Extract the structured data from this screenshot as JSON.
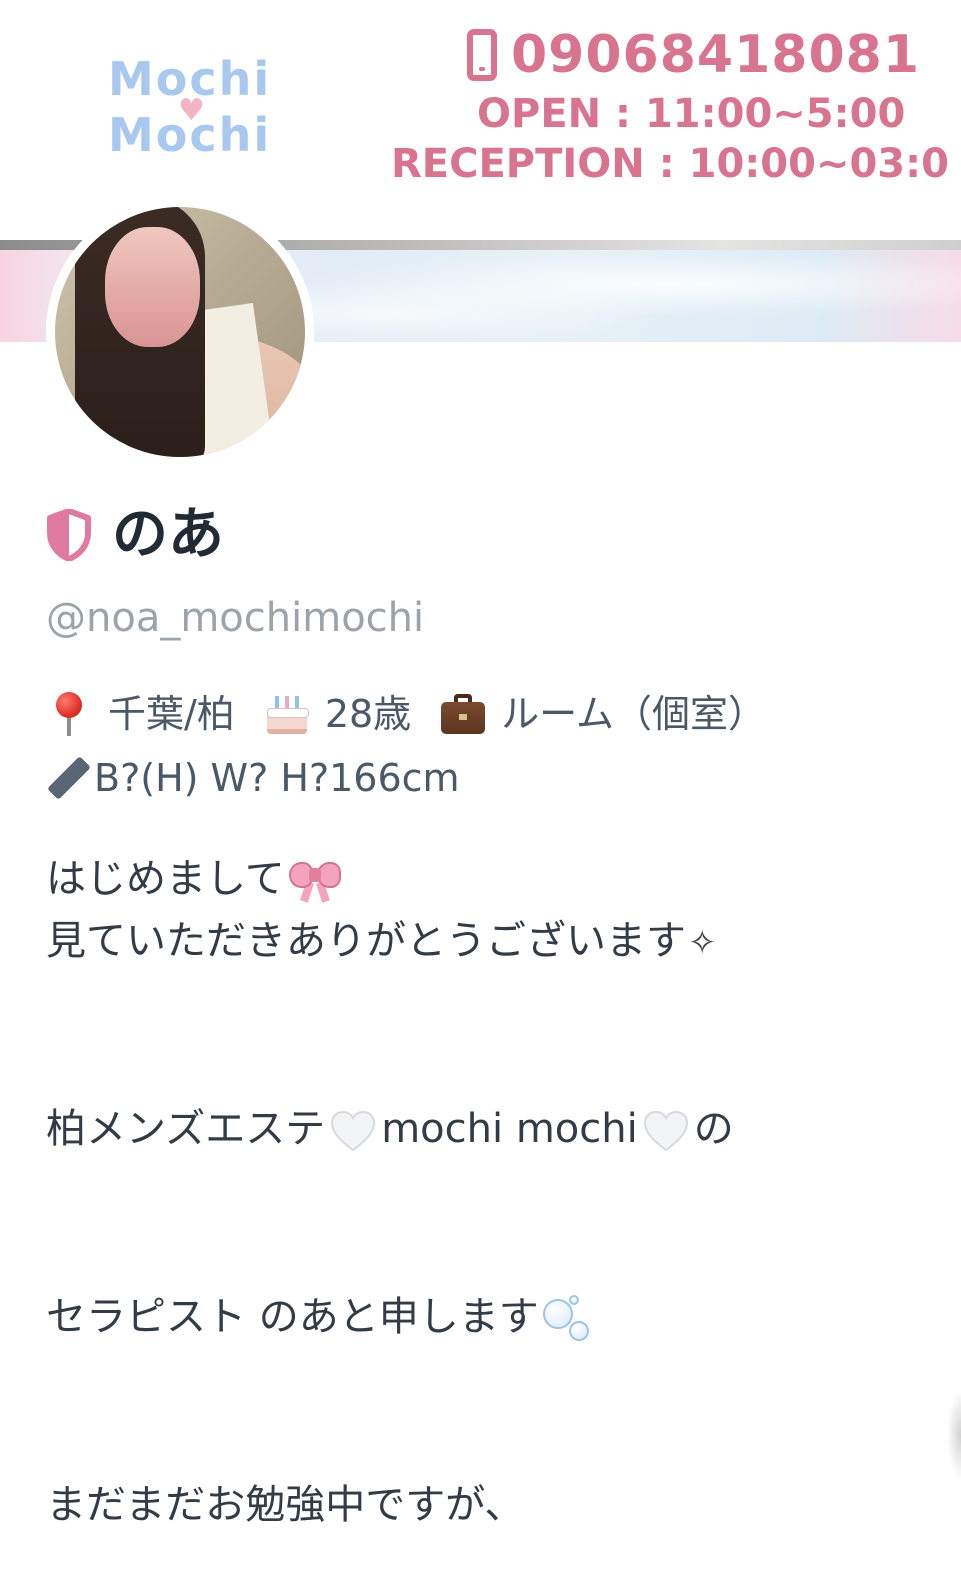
{
  "banner": {
    "logo_line1": "Mochi",
    "logo_line2": "Mochi",
    "phone": "09068418081",
    "open_hours": "OPEN : 11:00~5:00",
    "reception_hours": "RECEPTION : 10:00~03:0",
    "colors": {
      "contact_pink": "#d8748f",
      "logo_blue": "#a8c8ef"
    }
  },
  "profile": {
    "name": "のあ",
    "handle": "@noa_mochimochi",
    "badge_icon": "shield-icon",
    "badge_color": "#e07aa0",
    "location": "千葉/柏",
    "age": "28歳",
    "room": "ルーム（個室）",
    "measurements": "B?(H) W? H?166cm",
    "meta_icons": [
      "pin-icon",
      "cake-icon",
      "briefcase-icon",
      "ruler-icon"
    ]
  },
  "bio": {
    "line1": "はじめまして",
    "line2": "見ていただきありがとうございます",
    "line3_a": "柏メンズエステ",
    "line3_b": "mochi mochi",
    "line3_c": "の",
    "line4": "セラピスト のあと申します",
    "line5": "まだまだお勉強中ですが、",
    "sparkle": "✧",
    "emoji_icons": [
      "ribbon-icon",
      "sparkle-icon",
      "white-heart-icon",
      "bubbles-icon"
    ]
  }
}
